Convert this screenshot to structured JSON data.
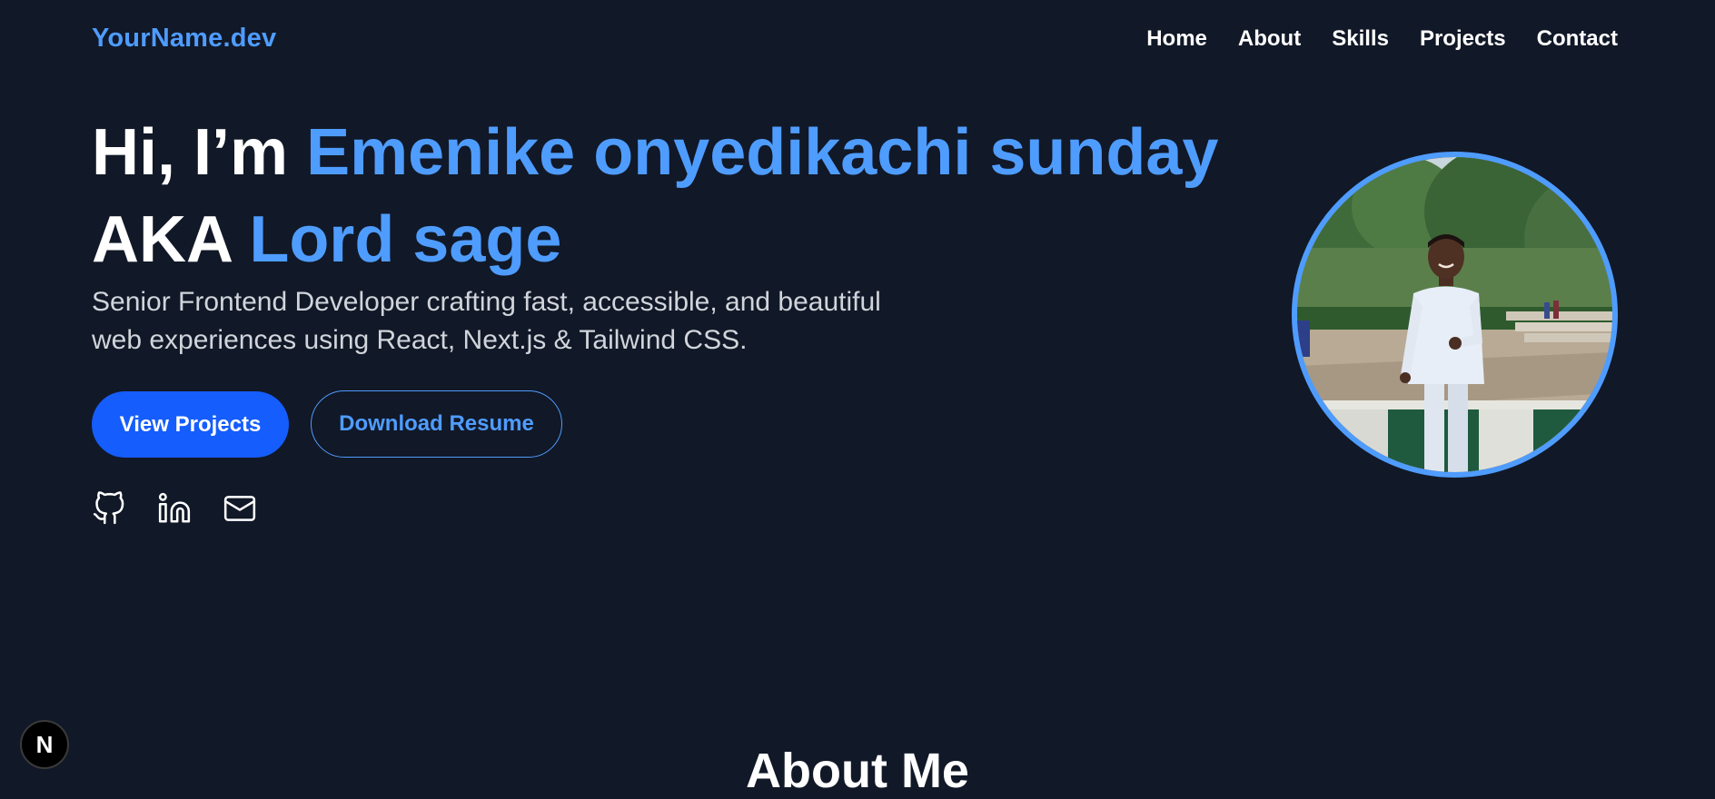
{
  "nav": {
    "brand": "YourName.dev",
    "links": [
      "Home",
      "About",
      "Skills",
      "Projects",
      "Contact"
    ]
  },
  "hero": {
    "greeting": "Hi, I’m",
    "name": "Emenike onyedikachi sunday",
    "aka_prefix": "AKA",
    "alias": "Lord sage",
    "subtitle_line1": "Senior Frontend Developer crafting fast, accessible, and beautiful",
    "subtitle_line2": "web experiences using React, Next.js & Tailwind CSS.",
    "primary_button": "View Projects",
    "secondary_button": "Download Resume",
    "socials": [
      "github-icon",
      "linkedin-icon",
      "mail-icon"
    ]
  },
  "about": {
    "title": "About Me"
  },
  "dev_badge": {
    "label": "N"
  },
  "colors": {
    "background": "#111827",
    "accent": "#4f9cff",
    "primary_button": "#155dfc",
    "subtitle": "#d1d5db"
  }
}
